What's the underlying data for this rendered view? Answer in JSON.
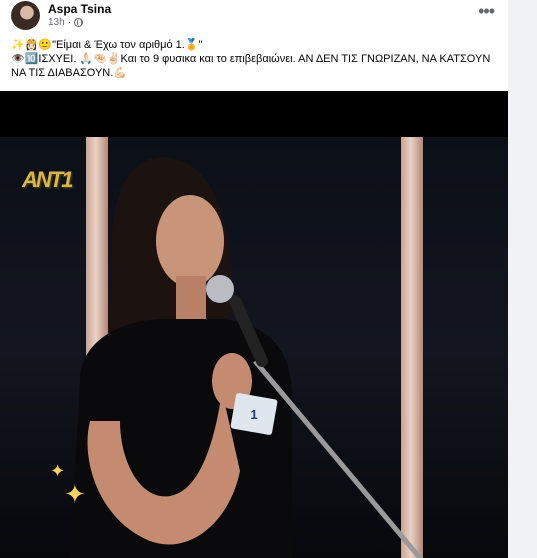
{
  "post": {
    "author": "Aspa Tsina",
    "timestamp": "13h",
    "privacy_icon": "globe-icon",
    "more_icon": "more-options-icon",
    "text_line1": "✨👸🏻🙂\"Είμαι & Έχω τον αριθμό 1.🏅\"",
    "text_line2": "👁️🔟ΙΣΧΥΕΙ. 🙏🏻🤏🏻✌🏻Και το 9 φυσικα και το επιβεβαιώνει. ΑΝ ΔΕΝ ΤΙΣ ΓΝΩΡΙΖΑΝ, ΝΑ ΚΑΤΣΟΥΝ ΝΑ ΤΙΣ ΔΙΑΒΑΣΟΥΝ.💪🏻"
  },
  "media": {
    "channel_logo": "ANT1",
    "contestant_badge": "1",
    "sparkle_icon": "sparkle-icon"
  },
  "colors": {
    "card_bg": "#ffffff",
    "page_bg": "#f0f2f5",
    "text_primary": "#050505",
    "text_secondary": "#65676b"
  }
}
